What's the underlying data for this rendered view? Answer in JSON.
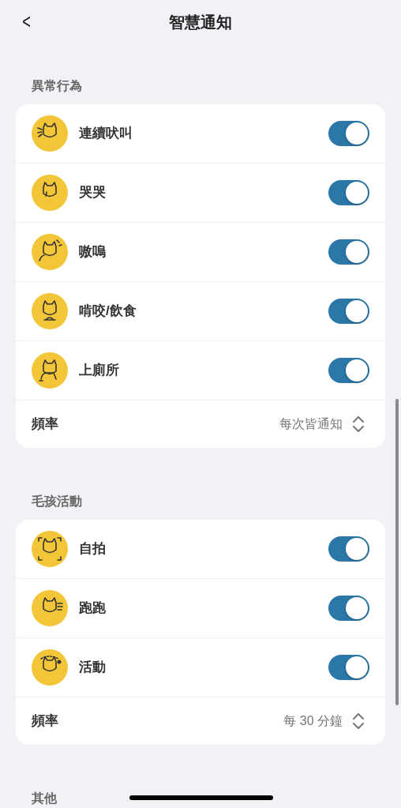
{
  "header": {
    "back": "<",
    "title": "智慧通知"
  },
  "sections": [
    {
      "label": "異常行為",
      "items": [
        {
          "label": "連續吠叫",
          "on": true
        },
        {
          "label": "哭哭",
          "on": true
        },
        {
          "label": "嗷嗚",
          "on": true
        },
        {
          "label": "啃咬/飲食",
          "on": true
        },
        {
          "label": "上廁所",
          "on": true
        }
      ],
      "frequency": {
        "label": "頻率",
        "value": "每次皆通知"
      }
    },
    {
      "label": "毛孩活動",
      "items": [
        {
          "label": "自拍",
          "on": true
        },
        {
          "label": "跑跑",
          "on": true
        },
        {
          "label": "活動",
          "on": true
        }
      ],
      "frequency": {
        "label": "頻率",
        "value": "每 30 分鐘"
      }
    },
    {
      "label": "其他"
    }
  ]
}
